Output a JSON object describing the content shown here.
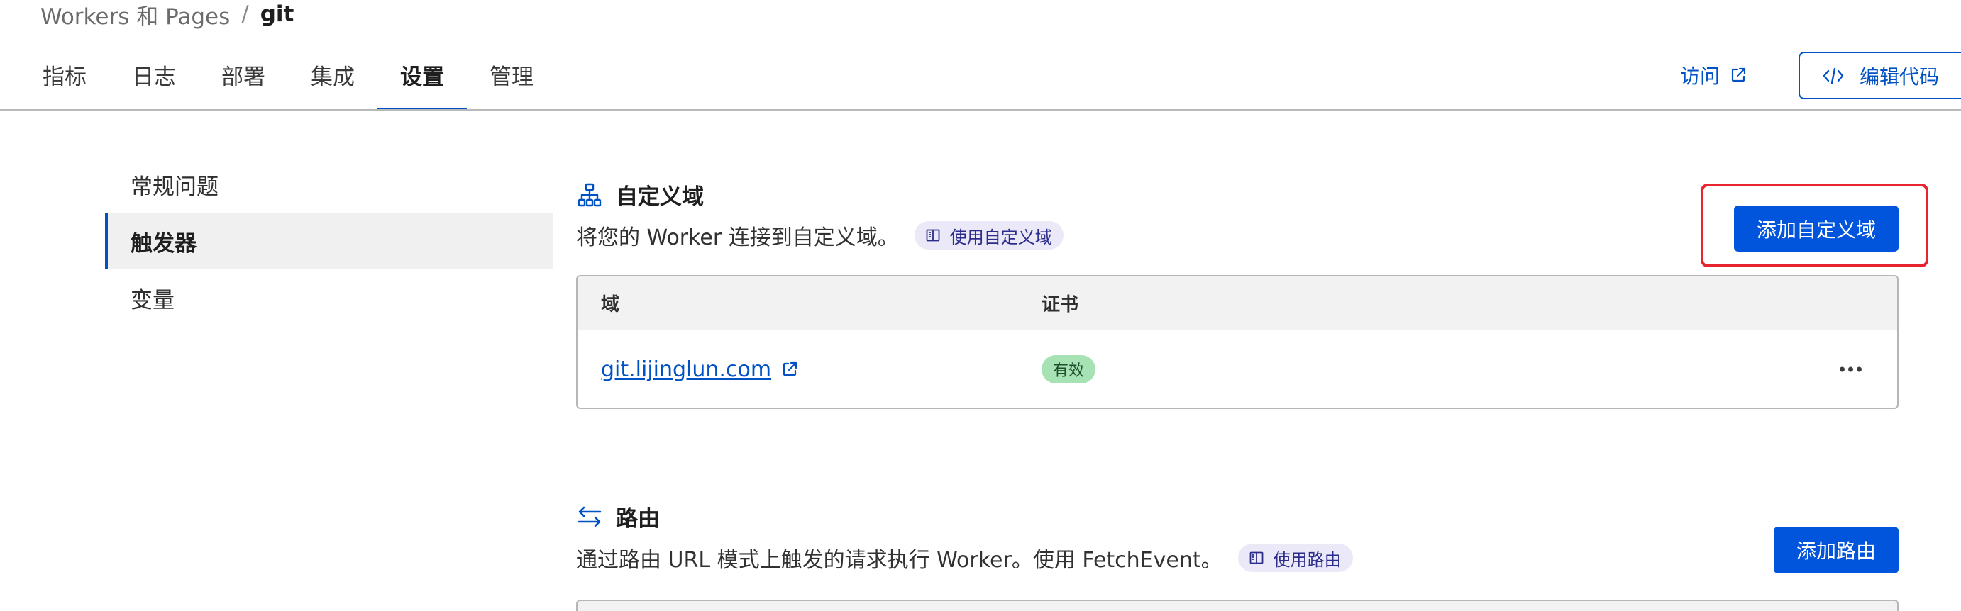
{
  "breadcrumb": {
    "parent": "Workers 和 Pages",
    "separator": "/",
    "current": "git"
  },
  "tabs": [
    {
      "label": "指标"
    },
    {
      "label": "日志"
    },
    {
      "label": "部署"
    },
    {
      "label": "集成"
    },
    {
      "label": "设置",
      "active": true
    },
    {
      "label": "管理"
    }
  ],
  "header_actions": {
    "visit_label": "访问",
    "edit_code_label": "编辑代码"
  },
  "side_nav": {
    "items": [
      {
        "label": "常规问题"
      },
      {
        "label": "触发器",
        "active": true
      },
      {
        "label": "变量"
      }
    ]
  },
  "custom_domains": {
    "icon": "sitemap-icon",
    "title": "自定义域",
    "description": "将您的 Worker 连接到自定义域。",
    "doc_link": "使用自定义域",
    "add_button": "添加自定义域",
    "columns": {
      "domain": "域",
      "certificate": "证书"
    },
    "rows": [
      {
        "domain": "git.lijinglun.com",
        "certificate_status": "有效"
      }
    ]
  },
  "routes": {
    "icon": "swap-arrows-icon",
    "title": "路由",
    "description": "通过路由 URL 模式上触发的请求执行 Worker。使用 FetchEvent。",
    "doc_link": "使用路由",
    "add_button": "添加路由"
  },
  "colors": {
    "accent": "#0051c3",
    "primary_button": "#0055dc",
    "highlight": "#e8242e",
    "success_badge": "#a6e2b4"
  }
}
